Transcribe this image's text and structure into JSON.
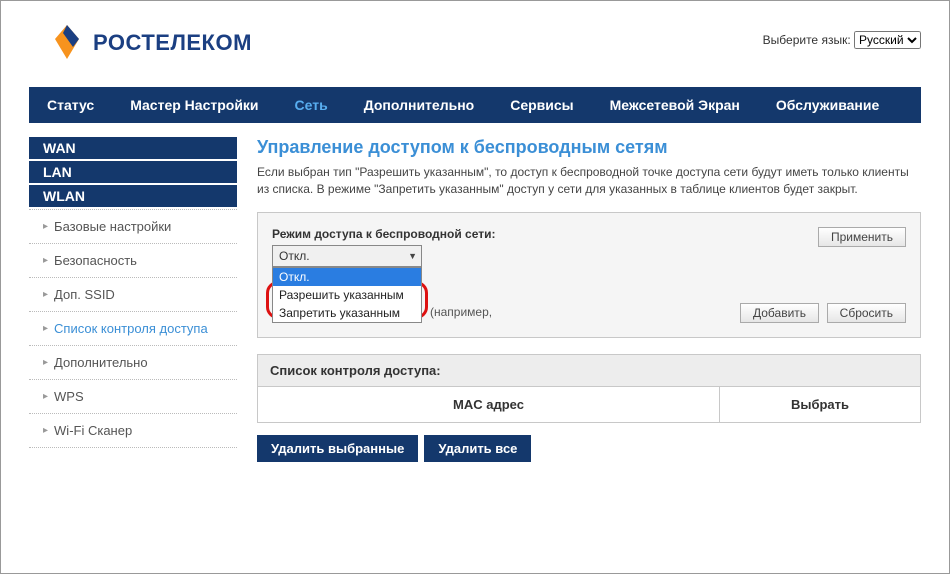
{
  "lang": {
    "label": "Выберите язык:",
    "selected": "Русский"
  },
  "brand": "РОСТЕЛЕКОМ",
  "mainnav": [
    {
      "label": "Статус"
    },
    {
      "label": "Мастер Настройки"
    },
    {
      "label": "Сеть",
      "active": true
    },
    {
      "label": "Дополнительно"
    },
    {
      "label": "Сервисы"
    },
    {
      "label": "Межсетевой Экран"
    },
    {
      "label": "Обслуживание"
    }
  ],
  "sidebar": {
    "groups": [
      {
        "label": "WAN"
      },
      {
        "label": "LAN"
      },
      {
        "label": "WLAN"
      }
    ],
    "subs": [
      {
        "label": "Базовые настройки"
      },
      {
        "label": "Безопасность"
      },
      {
        "label": "Доп. SSID"
      },
      {
        "label": "Список контроля доступа",
        "active": true
      },
      {
        "label": "Дополнительно"
      },
      {
        "label": "WPS"
      },
      {
        "label": "Wi-Fi Сканер"
      }
    ]
  },
  "page": {
    "title": "Управление доступом к беспроводным сетям",
    "desc": "Если выбран тип \"Разрешить указанным\", то доступ к беспроводной точке доступа сети будут иметь только клиенты из списка. В режиме \"Запретить указанным\" доступ у сети для указанных в таблице клиентов будет закрыт."
  },
  "form": {
    "mode_label": "Режим доступа к беспроводной сети:",
    "mode_value": "Откл.",
    "mode_options": [
      {
        "label": "Откл.",
        "selected": true
      },
      {
        "label": "Разрешить указанным"
      },
      {
        "label": "Запретить указанным"
      }
    ],
    "apply": "Применить",
    "mac_example": "(например,",
    "add": "Добавить",
    "reset": "Сбросить"
  },
  "acl": {
    "header": "Список контроля доступа:",
    "col_mac": "MAC адрес",
    "col_select": "Выбрать"
  },
  "actions": {
    "delete_selected": "Удалить выбранные",
    "delete_all": "Удалить все"
  }
}
